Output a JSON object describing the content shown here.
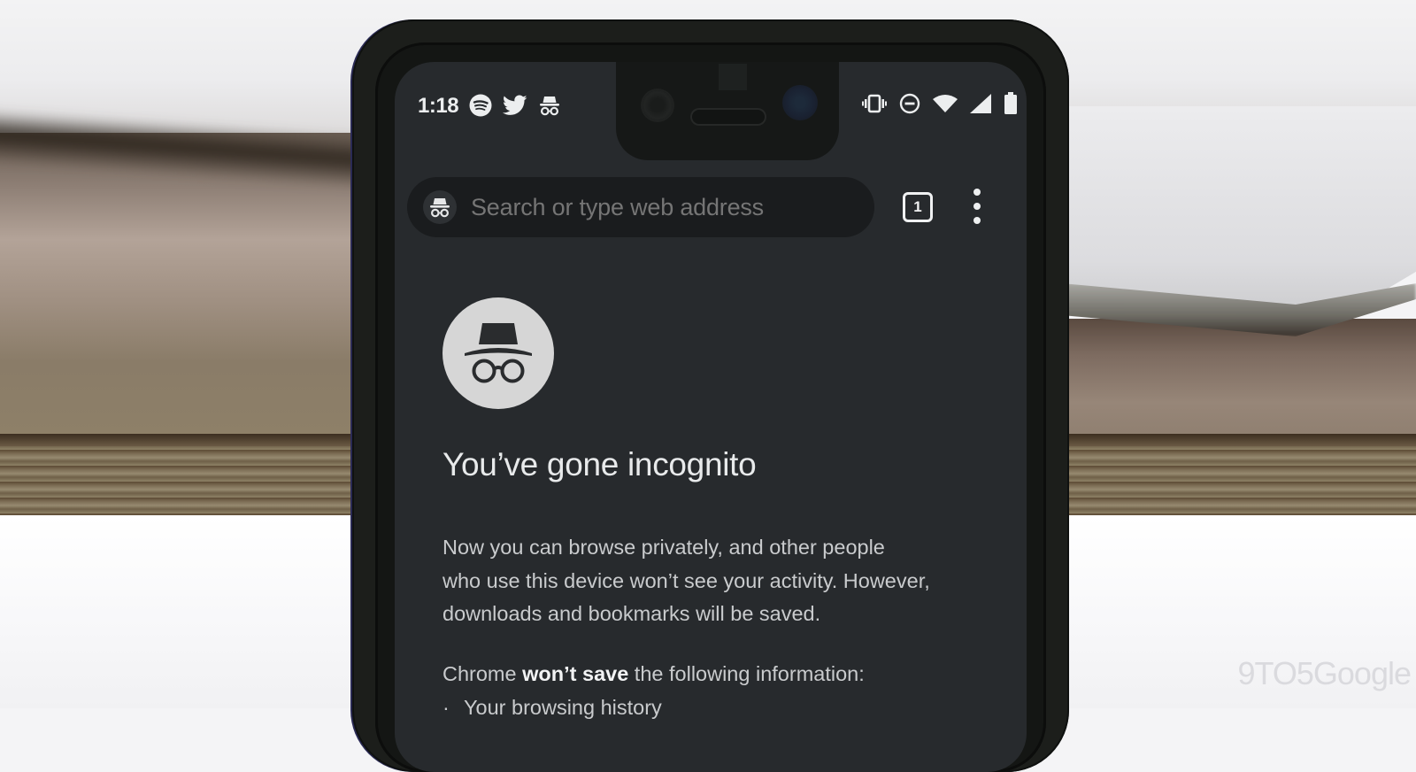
{
  "watermark": "9TO5Google",
  "status_bar": {
    "time": "1:18",
    "left_icons": [
      "spotify-icon",
      "twitter-icon",
      "incognito-icon"
    ],
    "right_icons": [
      "vibrate-icon",
      "do-not-disturb-icon",
      "wifi-icon",
      "cell-signal-icon",
      "battery-icon"
    ]
  },
  "toolbar": {
    "omnibox_placeholder": "Search or type web address",
    "tab_count": "1",
    "menu_icon": "more-vert-icon"
  },
  "ntp": {
    "icon": "incognito-icon",
    "title": "You’ve gone incognito",
    "description_lines": [
      "Now you can browse privately, and other people",
      "who use this device won’t see your activity. However,",
      "downloads and bookmarks will be saved."
    ],
    "nosave_prefix": "Chrome ",
    "nosave_bold": "won’t save",
    "nosave_suffix": " the following information:",
    "nosave_items": [
      "Your browsing history"
    ]
  },
  "colors": {
    "screen_bg": "#272a2d",
    "omnibox_bg": "#1a1c1e",
    "text_primary": "#e8eaeb",
    "text_secondary": "#c9cbcd",
    "icon_circle": "#d6d6d6"
  }
}
